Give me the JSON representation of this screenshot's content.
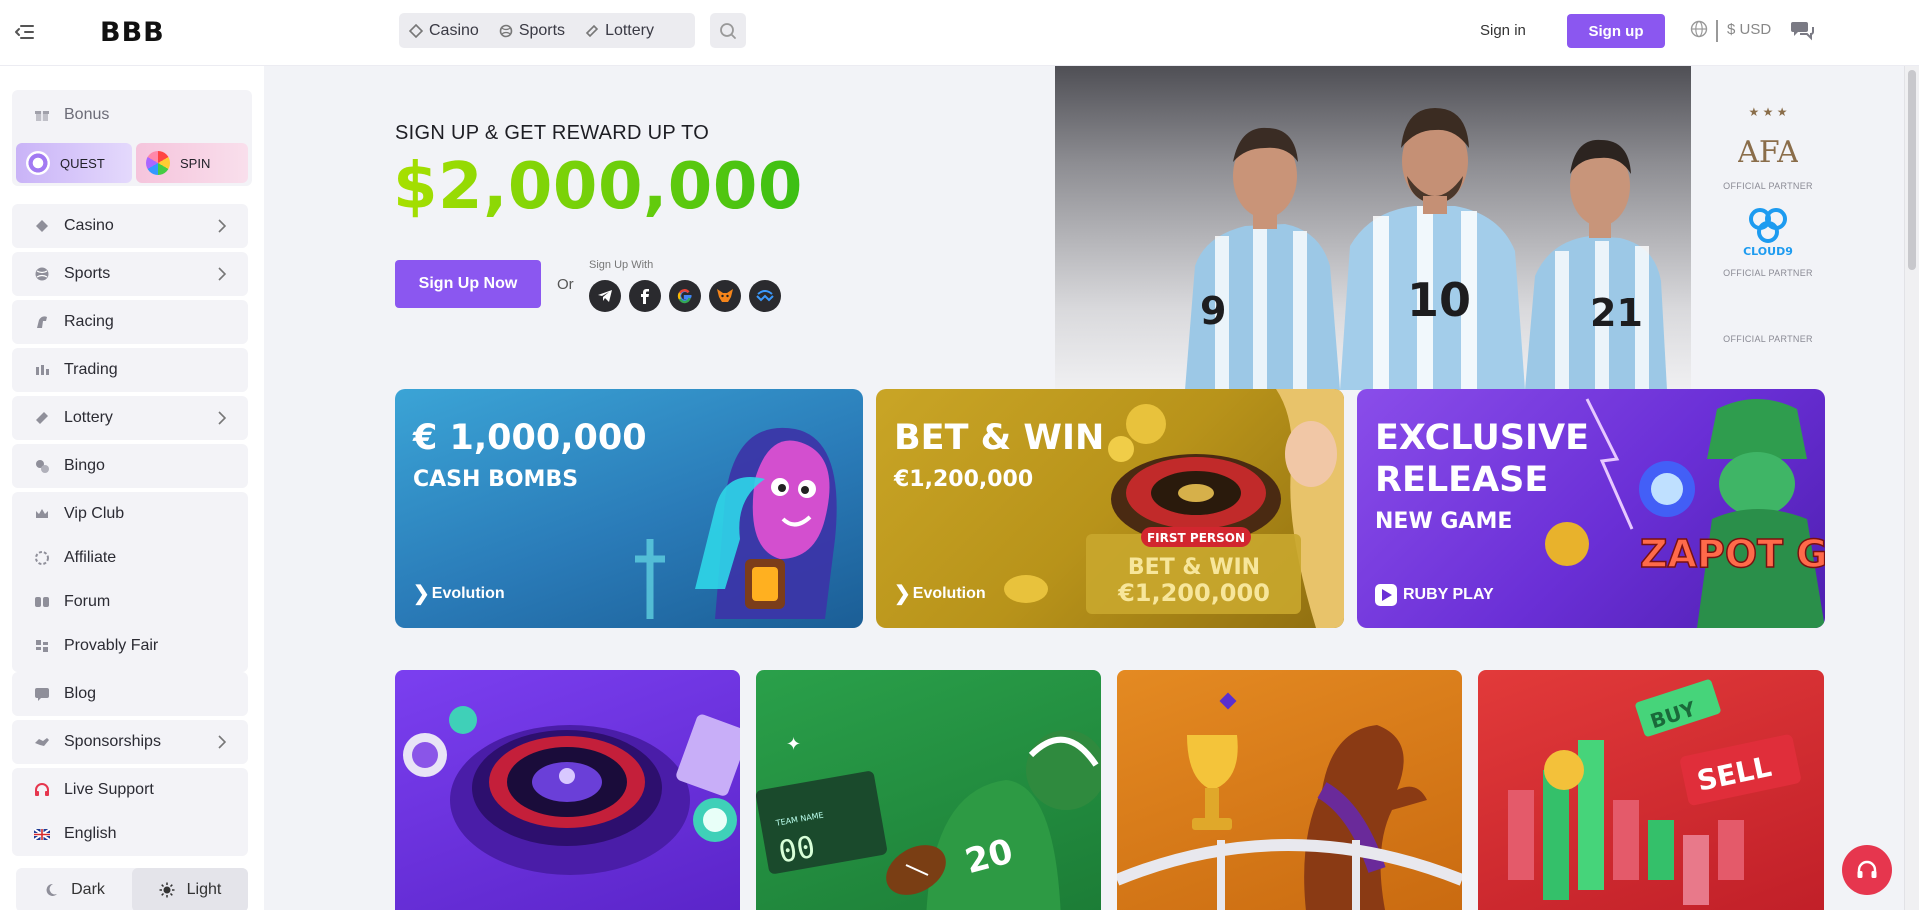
{
  "header": {
    "logo": "BBB",
    "nav": [
      {
        "label": "Casino"
      },
      {
        "label": "Sports"
      },
      {
        "label": "Lottery"
      }
    ],
    "sign_in": "Sign in",
    "sign_up": "Sign up",
    "currency": "$ USD"
  },
  "sidebar": {
    "bonus": "Bonus",
    "quest": "QUEST",
    "spin": "SPIN",
    "items": [
      {
        "label": "Casino"
      },
      {
        "label": "Sports"
      },
      {
        "label": "Racing"
      },
      {
        "label": "Trading"
      },
      {
        "label": "Lottery"
      },
      {
        "label": "Bingo"
      },
      {
        "label": "Vip Club"
      },
      {
        "label": "Affiliate"
      },
      {
        "label": "Forum"
      },
      {
        "label": "Provably Fair"
      },
      {
        "label": "Blog"
      },
      {
        "label": "Sponsorships"
      },
      {
        "label": "Live Support"
      },
      {
        "label": "English"
      }
    ],
    "theme": {
      "dark": "Dark",
      "light": "Light"
    }
  },
  "hero": {
    "headline": "SIGN UP & GET REWARD UP TO",
    "amount": "$2,000,000",
    "cta": "Sign Up Now",
    "or": "Or",
    "signup_with": "Sign Up With",
    "partners": [
      {
        "name": "AFA",
        "label": "OFFICIAL PARTNER"
      },
      {
        "name": "CLOUD9",
        "label": "OFFICIAL PARTNER"
      },
      {
        "name": "",
        "label": "OFFICIAL PARTNER"
      }
    ],
    "jerseys": [
      "9",
      "10",
      "21"
    ]
  },
  "promos": [
    {
      "title": "€ 1,000,000",
      "subtitle": "CASH BOMBS",
      "provider": "Evolution"
    },
    {
      "title": "BET & WIN",
      "subtitle": "€1,200,000",
      "provider": "Evolution",
      "badge": "FIRST PERSON",
      "art_text": "BET & WIN",
      "art_amount": "€1,200,000"
    },
    {
      "title": "EXCLUSIVE RELEASE",
      "subtitle": "NEW GAME",
      "provider": "RUBY PLAY",
      "art_text": "ZAPOT GOL"
    }
  ],
  "cards": [
    {
      "name": "casino"
    },
    {
      "name": "sports",
      "jersey": "20",
      "board_label": "TEAM NAME",
      "score": "00"
    },
    {
      "name": "racing"
    },
    {
      "name": "trading",
      "buy": "BUY",
      "sell": "SELL"
    }
  ],
  "colors": {
    "accent": "#8b57f0",
    "support": "#e6364e",
    "amount_start": "#a8e000",
    "amount_end": "#3bbf14"
  }
}
